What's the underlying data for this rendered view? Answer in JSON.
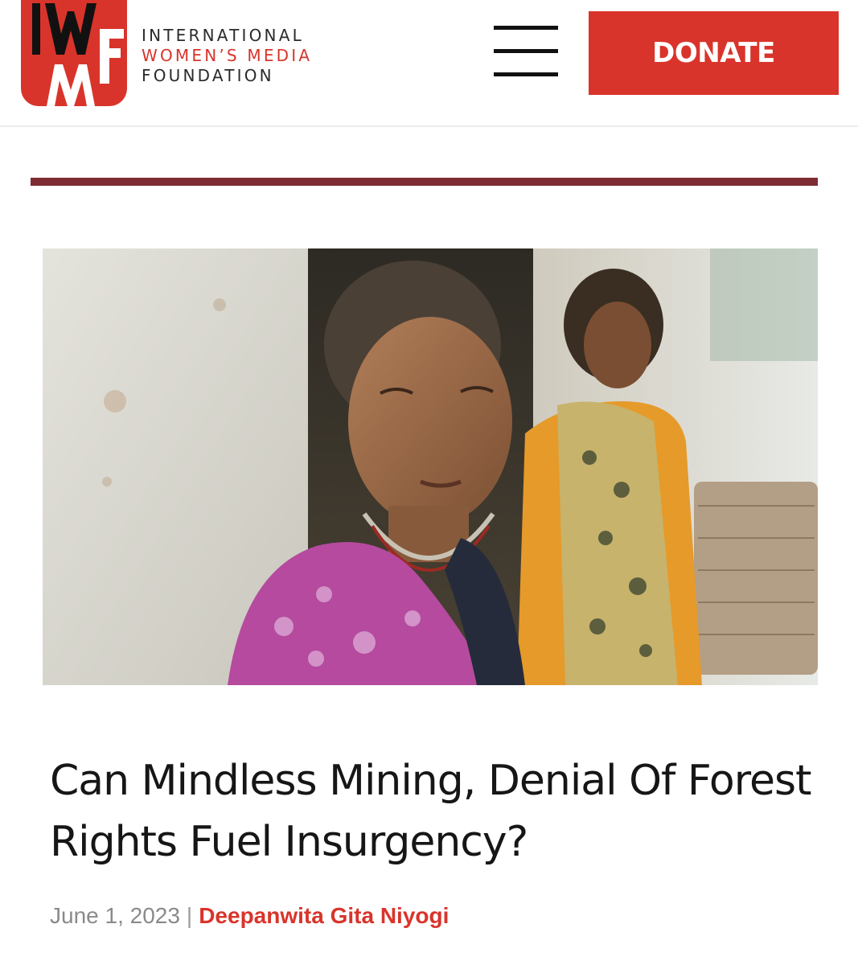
{
  "header": {
    "logo": {
      "mark_letters": "IWMF",
      "line1": "INTERNATIONAL",
      "line2": "WOMEN’S MEDIA",
      "line3": "FOUNDATION"
    },
    "menu_icon": "hamburger-menu-icon",
    "donate_label": "DONATE"
  },
  "colors": {
    "brand_red": "#d9342b",
    "rule_maroon": "#7d2c33",
    "text_dark": "#161616",
    "meta_gray": "#8a8a8a"
  },
  "article": {
    "hero_image": "photo-two-women-seated-at-doorway",
    "title": "Can Mindless Mining, Denial Of Forest Rights Fuel Insurgency?",
    "date": "June 1, 2023",
    "separator": "|",
    "author": "Deepanwita Gita Niyogi"
  }
}
